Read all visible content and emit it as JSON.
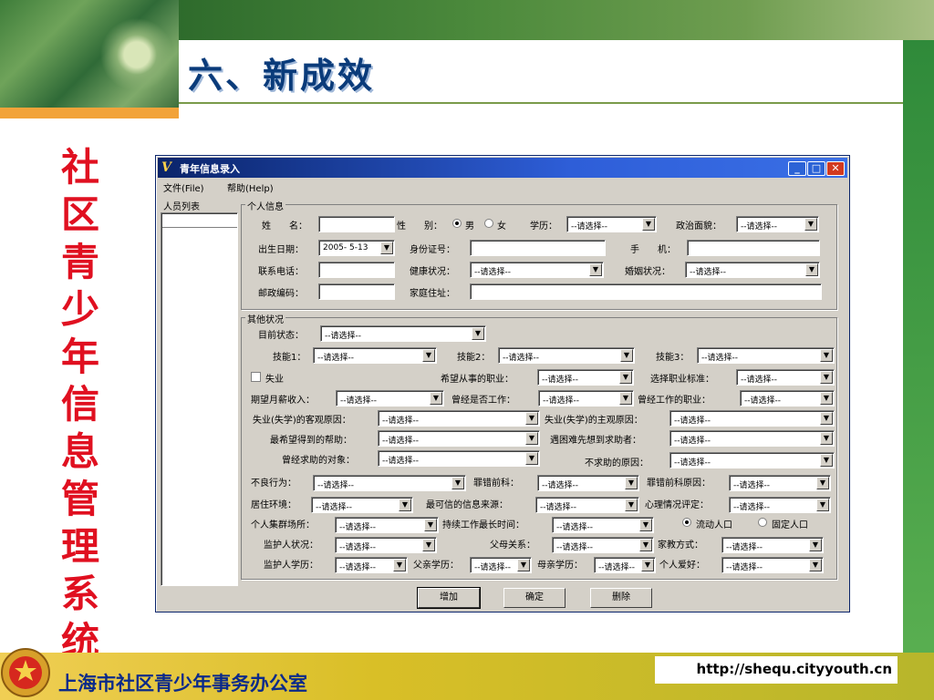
{
  "slide": {
    "title": "六、新成效",
    "vertical_title": "社区青少年信息管理系统",
    "footer_org": "上海市社区青少年事务办公室",
    "footer_url": "http://shequ.cityyouth.cn"
  },
  "window": {
    "title": "青年信息录入",
    "menu": {
      "file": "文件(File)",
      "help": "帮助(Help)"
    },
    "list_label": "人员列表",
    "personal": {
      "group_label": "个人信息",
      "name_label": "姓　　名：",
      "gender_label": "性　　别：",
      "male": "男",
      "female": "女",
      "education_label": "学历：",
      "education_value": "--请选择--",
      "politics_label": "政治面貌：",
      "politics_value": "--请选择--",
      "birth_label": "出生日期：",
      "birth_value": "2005- 5-13",
      "id_label": "身份证号：",
      "mobile_label": "手　　机：",
      "phone_label": "联系电话：",
      "health_label": "健康状况：",
      "health_value": "--请选择--",
      "marital_label": "婚姻状况：",
      "marital_value": "--请选择--",
      "zip_label": "邮政编码：",
      "address_label": "家庭住址："
    },
    "other": {
      "group_label": "其他状况",
      "status_label": "目前状态：",
      "status_value": "--请选择--",
      "skill1_label": "技能1：",
      "skill1_value": "--请选择--",
      "skill2_label": "技能2：",
      "skill2_value": "--请选择--",
      "skill3_label": "技能3：",
      "skill3_value": "--请选择--",
      "unemployed_label": "失业",
      "desired_job_label": "希望从事的职业：",
      "desired_job_value": "--请选择--",
      "job_criteria_label": "选择职业标准：",
      "job_criteria_value": "--请选择--",
      "expected_salary_label": "期望月薪收入：",
      "expected_salary_value": "--请选择--",
      "worked_before_label": "曾经是否工作：",
      "worked_before_value": "--请选择--",
      "past_job_label": "曾经工作的职业：",
      "past_job_value": "--请选择--",
      "objective_reason_label": "失业(失学)的客观原因：",
      "objective_reason_value": "--请选择--",
      "subjective_reason_label": "失业(失学)的主观原因：",
      "subjective_reason_value": "--请选择--",
      "help_wanted_label": "最希望得到的帮助：",
      "help_wanted_value": "--请选择--",
      "difficulty_contact_label": "遇困难先想到求助者：",
      "difficulty_contact_value": "--请选择--",
      "sought_help_label": "曾经求助的对象：",
      "sought_help_value": "--请选择--",
      "no_help_reason_label": "不求助的原因：",
      "no_help_reason_value": "--请选择--",
      "bad_behavior_label": "不良行为：",
      "bad_behavior_value": "--请选择--",
      "crime_label": "罪错前科：",
      "crime_value": "--请选择--",
      "crime_reason_label": "罪错前科原因：",
      "crime_reason_value": "--请选择--",
      "living_env_label": "居住环境：",
      "living_env_value": "--请选择--",
      "info_source_label": "最可信的信息来源：",
      "info_source_value": "--请选择--",
      "mental_label": "心理情况评定：",
      "mental_value": "--请选择--",
      "gathering_label": "个人集群场所：",
      "gathering_value": "--请选择--",
      "longest_work_label": "持续工作最长时间：",
      "longest_work_value": "--请选择--",
      "floating_label": "流动人口",
      "fixed_label": "固定人口",
      "guardian_status_label": "监护人状况：",
      "guardian_status_value": "--请选择--",
      "parent_rel_label": "父母关系：",
      "parent_rel_value": "--请选择--",
      "parenting_label": "家教方式：",
      "parenting_value": "--请选择--",
      "guardian_edu_label": "监护人学历：",
      "guardian_edu_value": "--请选择--",
      "father_edu_label": "父亲学历：",
      "father_edu_value": "--请选择--",
      "mother_edu_label": "母亲学历：",
      "mother_edu_value": "--请选择--",
      "hobby_label": "个人爱好：",
      "hobby_value": "--请选择--"
    },
    "buttons": {
      "add": "增加",
      "confirm": "确定",
      "delete": "删除"
    }
  }
}
